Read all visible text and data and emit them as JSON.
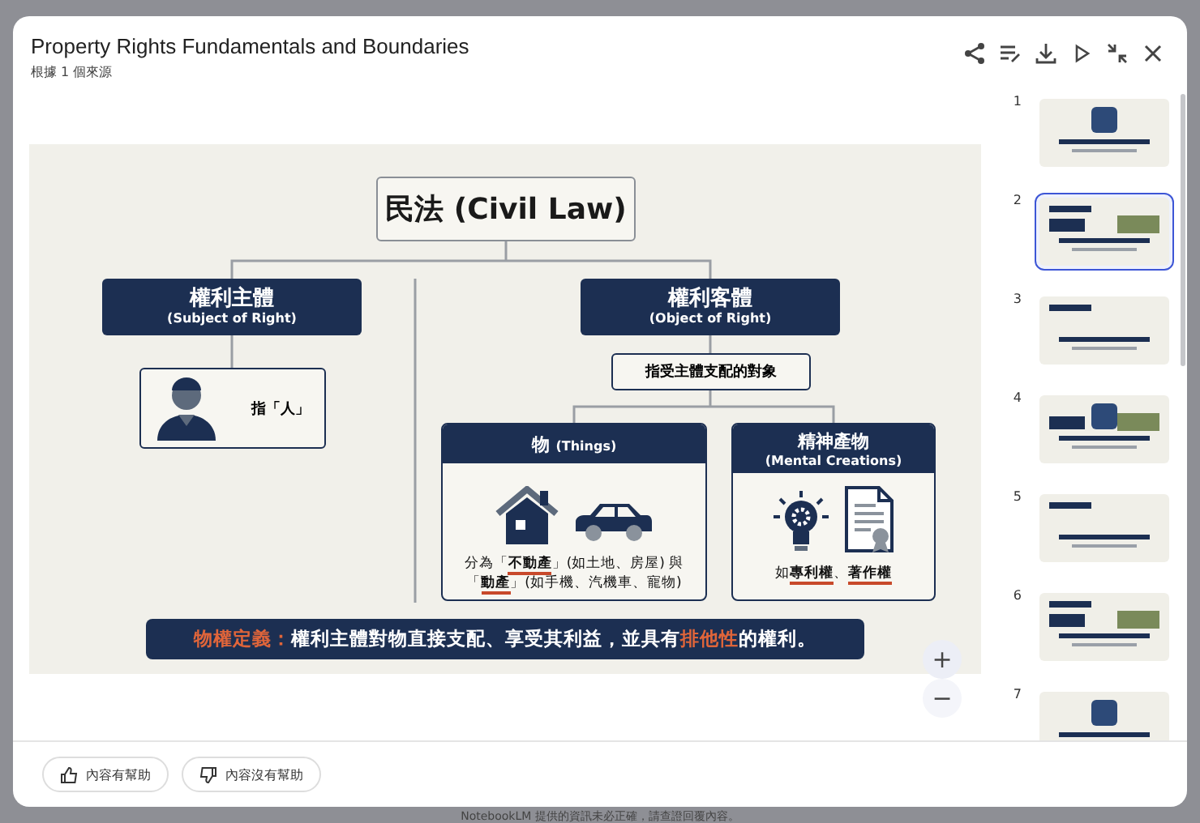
{
  "window": {
    "title": "Property Rights Fundamentals and Boundaries",
    "subtitle": "根據 1 個來源"
  },
  "slide": {
    "root": "民法 (Civil Law)",
    "subject": {
      "title": "權利主體",
      "subtitle": "(Subject of Right)",
      "note": "指「人」"
    },
    "object": {
      "title": "權利客體",
      "subtitle": "(Object of Right)",
      "note": "指受主體支配的對象"
    },
    "categories": [
      {
        "kind": "things",
        "title": "物",
        "subtitle": "(Things)",
        "lines": [
          "分為「**不動產**」(如土地、房屋) 與",
          "「**動產**」(如手機、汽機車、寵物)"
        ]
      },
      {
        "kind": "mental",
        "title": "精神產物",
        "subtitle": "(Mental Creations)",
        "lines": [
          "如**專利權**、**著作權**"
        ]
      }
    ],
    "definition": "**物權定義：**權利主體對物直接支配、享受其利益，並具有**排他性**的權利。"
  },
  "zoom_controls": [
    "+",
    "−"
  ],
  "thumbnails": [
    {
      "number": "1",
      "selected": false
    },
    {
      "number": "2",
      "selected": true
    },
    {
      "number": "3",
      "selected": false
    },
    {
      "number": "4",
      "selected": false
    },
    {
      "number": "5",
      "selected": false
    },
    {
      "number": "6",
      "selected": false
    },
    {
      "number": "7",
      "selected": false
    }
  ],
  "feedback_buttons": [
    {
      "kind": "up",
      "label": "內容有幫助"
    },
    {
      "kind": "down",
      "label": "內容沒有幫助"
    }
  ],
  "disclaimer": "NotebookLM 提供的資訊未必正確，請查證回覆內容。"
}
